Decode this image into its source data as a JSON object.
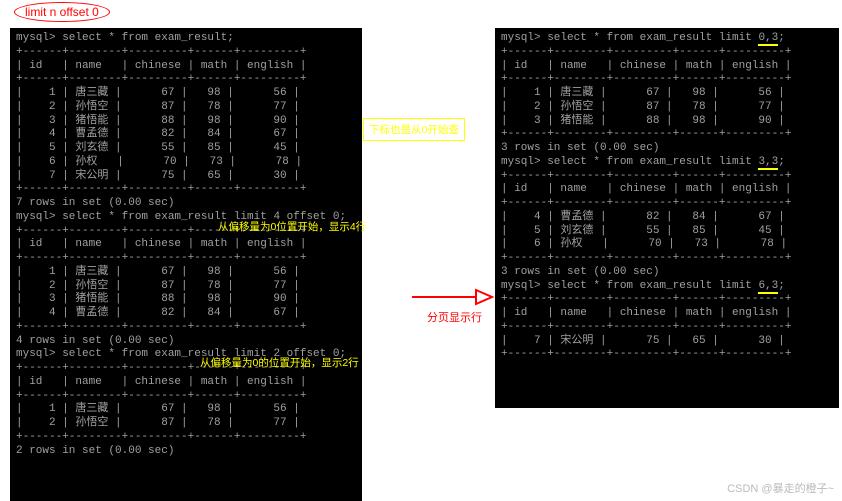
{
  "header_annotation": "limit n offset 0",
  "left_terminal": {
    "query1": "mysql> select * from exam_result;",
    "border_top": "+------+--------+---------+------+---------+",
    "header": "| id   | name   | chinese | math | english |",
    "rows": [
      "|    1 | 唐三藏 |      67 |   98 |      56 |",
      "|    2 | 孙悟空 |      87 |   78 |      77 |",
      "|    3 | 猪悟能 |      88 |   98 |      90 |",
      "|    4 | 曹孟德 |      82 |   84 |      67 |",
      "|    5 | 刘玄德 |      55 |   85 |      45 |",
      "|    6 | 孙权   |      70 |   73 |      78 |",
      "|    7 | 宋公明 |      75 |   65 |      30 |"
    ],
    "result1": "7 rows in set (0.00 sec)",
    "note1": "从偏移量为0位置开始，显示4行",
    "query2": "mysql> select * from exam_result limit 4 offset 0;",
    "rows2": [
      "|    1 | 唐三藏 |      67 |   98 |      56 |",
      "|    2 | 孙悟空 |      87 |   78 |      77 |",
      "|    3 | 猪悟能 |      88 |   98 |      90 |",
      "|    4 | 曹孟德 |      82 |   84 |      67 |"
    ],
    "result2": "4 rows in set (0.00 sec)",
    "note2": "从偏移量为0的位置开始，显示2行",
    "query3": "mysql> select * from exam_result limit 2 offset 0;",
    "rows3": [
      "|    1 | 唐三藏 |      67 |   98 |      56 |",
      "|    2 | 孙悟空 |      87 |   78 |      77 |"
    ],
    "result3": "2 rows in set (0.00 sec)"
  },
  "right_terminal": {
    "query1": "mysql> select * from exam_result limit 0,3;",
    "header": "| id   | name   | chinese | math | english |",
    "border": "+------+--------+---------+------+---------+",
    "rows1": [
      "|    1 | 唐三藏 |      67 |   98 |      56 |",
      "|    2 | 孙悟空 |      87 |   78 |      77 |",
      "|    3 | 猪悟能 |      88 |   98 |      90 |"
    ],
    "result1": "3 rows in set (0.00 sec)",
    "query2": "mysql> select * from exam_result limit 3,3;",
    "rows2": [
      "|    4 | 曹孟德 |      82 |   84 |      67 |",
      "|    5 | 刘玄德 |      55 |   85 |      45 |",
      "|    6 | 孙权   |      70 |   73 |      78 |"
    ],
    "result2": "3 rows in set (0.00 sec)",
    "query3": "mysql> select * from exam_result limit 6,3;",
    "rows3": [
      "|    7 | 宋公明 |      75 |   65 |      30 |"
    ]
  },
  "callout_box": "下标也是从0开始查",
  "arrow_label": "分页显示行",
  "mark1": "0,3",
  "mark2": "3,3",
  "mark3": "6,3",
  "watermark": "CSDN @暴走的橙子~"
}
